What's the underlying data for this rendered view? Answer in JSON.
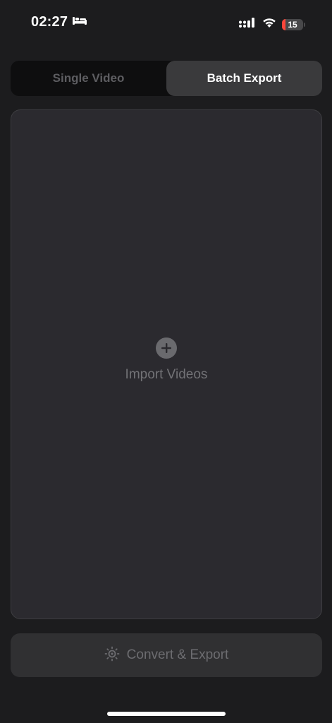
{
  "status_bar": {
    "time": "02:27",
    "sleep_icon": "bed-icon",
    "signal_icon": "cellular-signal-icon",
    "wifi_icon": "wifi-icon",
    "battery_level": "15",
    "battery_fraction": 0.15,
    "battery_color": "#ff453a"
  },
  "mode_toggle": {
    "options": [
      {
        "label": "Single Video",
        "selected": false
      },
      {
        "label": "Batch Export",
        "selected": true
      }
    ]
  },
  "import": {
    "icon": "plus-circle-icon",
    "label": "Import Videos"
  },
  "convert": {
    "icon": "sparkle-sun-icon",
    "label": "Convert & Export",
    "enabled": false
  },
  "colors": {
    "background": "#1c1c1e",
    "panel": "#2b2a2f",
    "segment_active": "#3a3a3c"
  }
}
